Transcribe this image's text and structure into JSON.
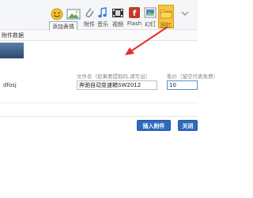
{
  "toolbar": {
    "tools": [
      {
        "id": "emoji",
        "label": "",
        "icon": "emoji-icon"
      },
      {
        "id": "image",
        "label": "",
        "icon": "image-icon"
      },
      {
        "id": "attachment",
        "label": "附件",
        "icon": "attachment-icon"
      },
      {
        "id": "music",
        "label": "音乐",
        "icon": "music-icon"
      },
      {
        "id": "video",
        "label": "视频",
        "icon": "video-icon"
      },
      {
        "id": "flash",
        "label": "Flash",
        "icon": "flash-icon"
      },
      {
        "id": "slideshow",
        "label": "幻灯",
        "icon": "slideshow-icon"
      },
      {
        "id": "box",
        "label": "回忆",
        "icon": "folder-icon"
      },
      {
        "id": "more",
        "label": "",
        "icon": "chevron-icon"
      }
    ],
    "tooltip": "添加表情"
  },
  "subbar": {
    "crumb": "附件数据"
  },
  "attachment_form": {
    "filename_tail": "dfosj",
    "name_label": "文件名（如果要提取码,请写出）",
    "name_value": "奔驰自动变速箱SW2012",
    "price_label": "售价（留空代表免费）",
    "price_value": "10"
  },
  "buttons": {
    "insert": "插入附件",
    "close": "关闭"
  },
  "colors": {
    "accent": "#2d6bbf",
    "active_tool_bg": "#f6c343",
    "arrow": "#e03030"
  }
}
